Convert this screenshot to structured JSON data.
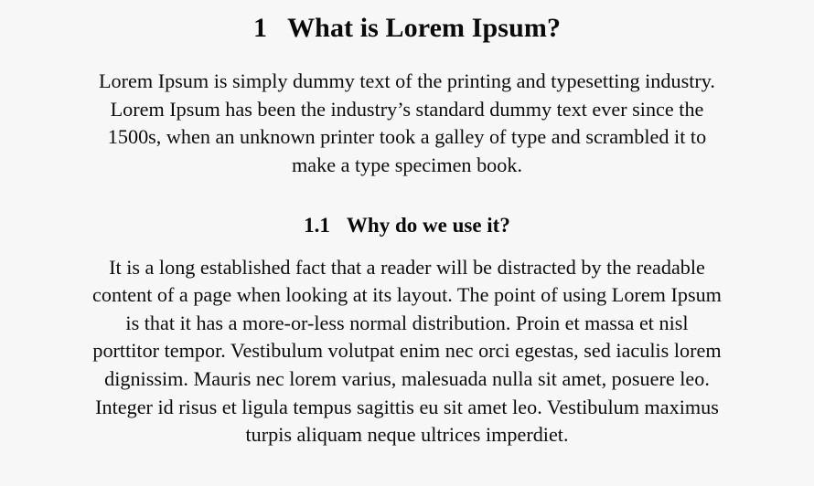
{
  "document": {
    "background_color": "#f7f7f7",
    "text_color": "#0a0a0a",
    "section": {
      "number": "1",
      "title": "What is Lorem Ipsum?",
      "paragraph": {
        "full_text": "Lorem Ipsum is simply dummy text of the printing and typesetting industry. Lorem Ipsum has been the industry’s standard dummy text ever since the 1500s, when an unknown printer took a galley of type and scrambled it to make a type specimen book.",
        "lines": [
          "Lorem Ipsum is simply dummy text of the printing and typesetting industry.",
          "Lorem Ipsum has been the industry’s standard dummy text ever since the",
          "1500s, when an unknown printer took a galley of type and scrambled it to",
          "make a type specimen book."
        ]
      }
    },
    "subsection": {
      "number": "1.1",
      "title": "Why do we use it?",
      "paragraph": {
        "full_text": "It is a long established fact that a reader will be distracted by the readable content of a page when looking at its layout. The point of using Lorem Ipsum is that it has a more-or-less normal distribution. Proin et massa et nisl porttitor tempor. Vestibulum volutpat enim nec orci egestas, sed iaculis lorem dignissim. Mauris nec lorem varius, malesuada nulla sit amet, posuere leo. Integer id risus et ligula tempus sagittis eu sit amet leo. Vestibulum maximus turpis aliquam neque ultrices imperdiet.",
        "lines": [
          "It is a long established fact that a reader will be distracted by the readable",
          "content of a page when looking at its layout. The point of using Lorem Ipsum",
          "is that it has a more-or-less normal distribution. Proin et massa et nisl",
          "porttitor tempor. Vestibulum volutpat enim nec orci egestas, sed iaculis lorem",
          "dignissim. Mauris nec lorem varius, malesuada nulla sit amet, posuere leo.",
          "Integer id risus et ligula tempus sagittis eu sit amet leo. Vestibulum maximus",
          "turpis aliquam neque ultrices imperdiet."
        ]
      }
    }
  }
}
